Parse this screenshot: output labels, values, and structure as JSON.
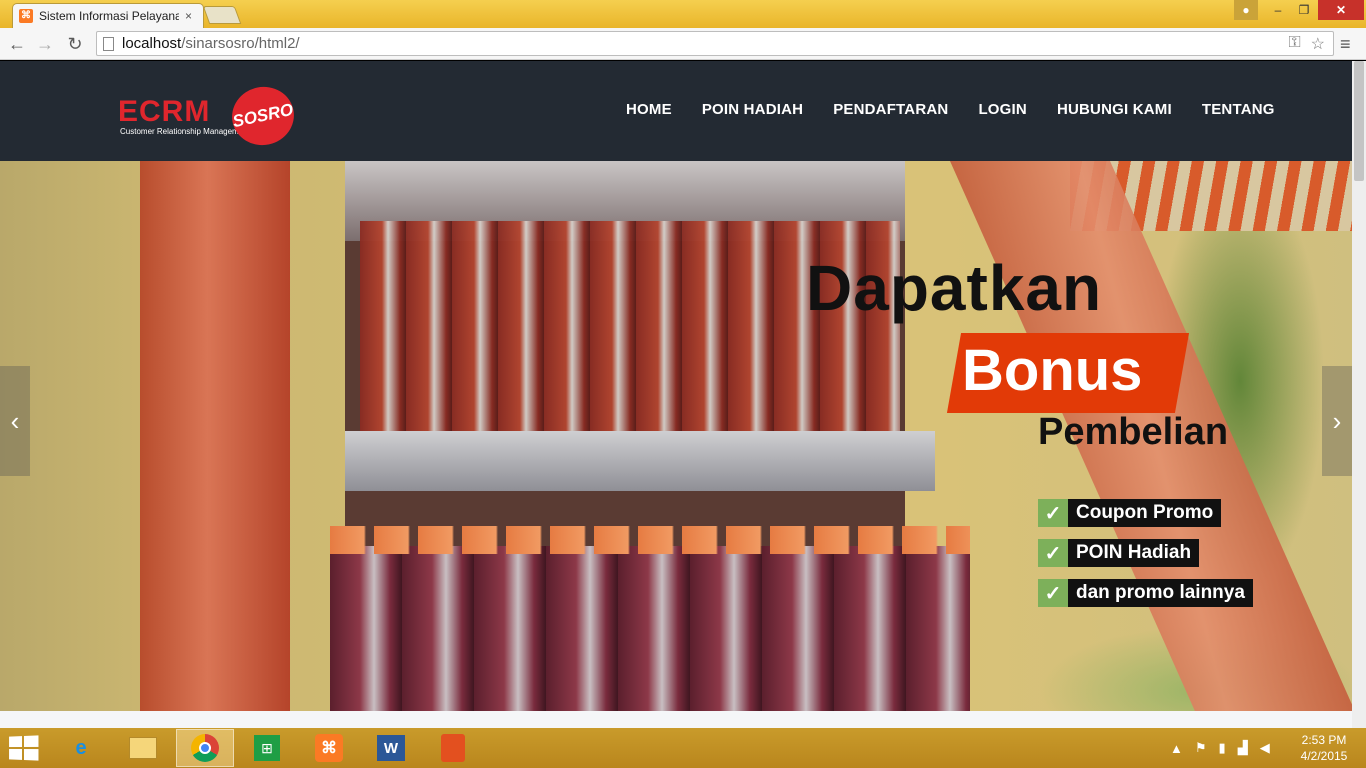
{
  "browser": {
    "tab_title": "Sistem Informasi Pelayana",
    "tab_close": "×",
    "url_host": "localhost",
    "url_path": "/sinarsosro/html2/"
  },
  "window": {
    "minimize": "–",
    "maximize": "❐",
    "close": "✕"
  },
  "site": {
    "logo_text": "ECRM",
    "logo_tagline": "Customer Relationship Management",
    "logo_badge": "SOSRO",
    "nav": [
      "HOME",
      "POIN HADIAH",
      "PENDAFTARAN",
      "LOGIN",
      "HUBUNGI KAMI",
      "TENTANG"
    ]
  },
  "hero": {
    "headline": "Dapatkan",
    "bonus": "Bonus",
    "subhead": "Pembelian",
    "features": [
      "Coupon Promo",
      "POIN Hadiah",
      "dan promo lainnya"
    ],
    "prev_arrow": "‹",
    "next_arrow": "›"
  },
  "taskbar": {
    "time": "2:53 PM",
    "date": "4/2/2015",
    "ie_glyph": "e",
    "word_glyph": "W"
  },
  "colors": {
    "header_bg": "#232a33",
    "brand_red": "#e0262d",
    "bonus_bg": "#e23a07",
    "check_green": "#7db05a",
    "taskbar": "#c99b2b"
  }
}
